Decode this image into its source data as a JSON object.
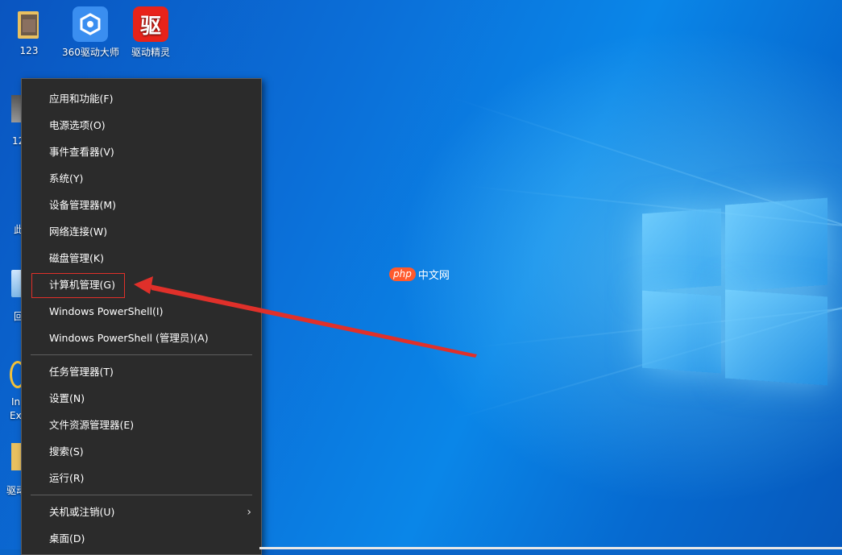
{
  "desktop": {
    "icons": [
      {
        "label": "123"
      },
      {
        "label": "360驱动大师"
      },
      {
        "label": "驱动精灵",
        "glyph_text": "驱"
      }
    ],
    "partial_labels": [
      "12",
      "此",
      "回",
      "In",
      "Ex",
      "驱动"
    ]
  },
  "watermark": {
    "brand": "php",
    "text": "中文网"
  },
  "context_menu": {
    "items": [
      {
        "label": "应用和功能(F)"
      },
      {
        "label": "电源选项(O)"
      },
      {
        "label": "事件查看器(V)"
      },
      {
        "label": "系统(Y)"
      },
      {
        "label": "设备管理器(M)"
      },
      {
        "label": "网络连接(W)"
      },
      {
        "label": "磁盘管理(K)"
      },
      {
        "label": "计算机管理(G)"
      },
      {
        "label": "Windows PowerShell(I)"
      },
      {
        "label": "Windows PowerShell (管理员)(A)"
      },
      {
        "label": "任务管理器(T)"
      },
      {
        "label": "设置(N)"
      },
      {
        "label": "文件资源管理器(E)"
      },
      {
        "label": "搜索(S)"
      },
      {
        "label": "运行(R)"
      },
      {
        "label": "关机或注销(U)",
        "submenu_glyph": "›"
      },
      {
        "label": "桌面(D)"
      }
    ]
  },
  "colors": {
    "menu_bg": "#2b2b2b",
    "highlight": "#e0302a",
    "arrow": "#e0302a"
  }
}
